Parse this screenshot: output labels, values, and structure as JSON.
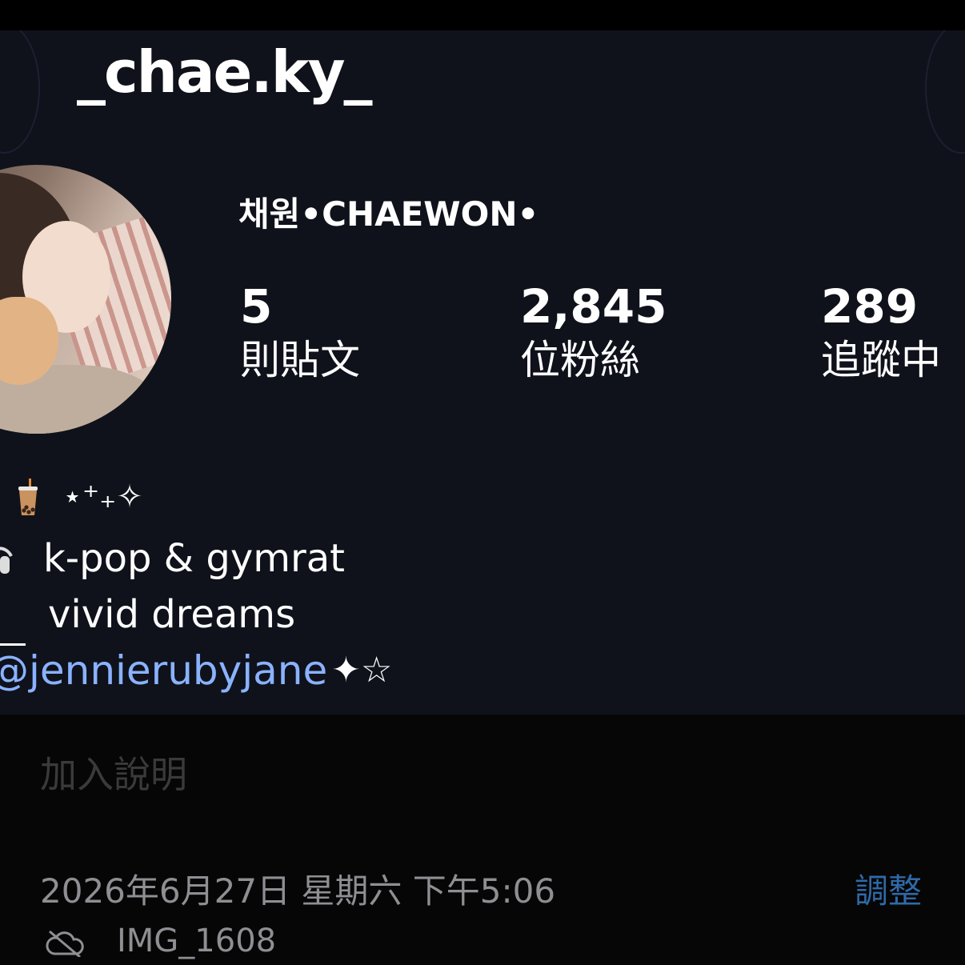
{
  "profile": {
    "username": "_chae.ky_",
    "display_name": "채원•CHAEWON•",
    "stats": [
      {
        "value": "5",
        "label": "則貼文"
      },
      {
        "value": "2,845",
        "label": "位粉絲"
      },
      {
        "value": "289",
        "label": "追蹤中"
      }
    ],
    "bio": {
      "line1_sparkles": "⋆⁺₊✧",
      "line2_text": "k-pop  &  gymrat",
      "line3_text": "vivid dreams",
      "mention": "@jennierubyjane",
      "mention_suffix": "✦☆"
    }
  },
  "photo_info": {
    "caption_placeholder": "加入說明",
    "datetime": "2026年6月27日 星期六 下午5:06",
    "adjust_label": "調整",
    "file_name": "IMG_1608"
  },
  "icons": [
    "boba-tea-icon",
    "headphones-icon",
    "cloud-off-icon"
  ],
  "colors": {
    "card_background": "#0f121b",
    "mention": "#8ab2ff",
    "adjust": "#2f6aa8"
  }
}
